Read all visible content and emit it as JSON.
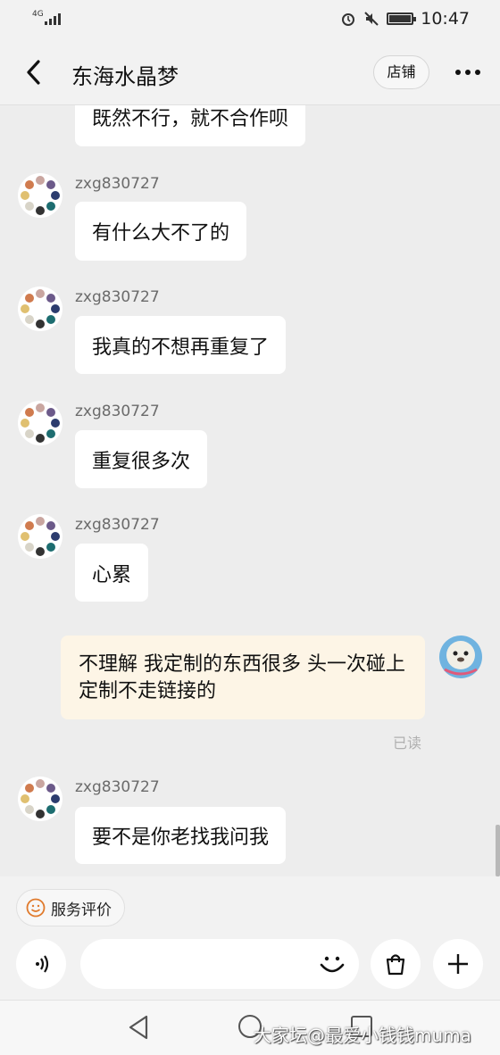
{
  "status_bar": {
    "network": "4G",
    "time": "10:47"
  },
  "header": {
    "title": "东海水晶梦",
    "shop_label": "店铺"
  },
  "messages": [
    {
      "sender": "",
      "text": "既然不行，就不合作呗"
    },
    {
      "sender": "zxg830727",
      "text": "有什么大不了的"
    },
    {
      "sender": "zxg830727",
      "text": "我真的不想再重复了"
    },
    {
      "sender": "zxg830727",
      "text": "重复很多次"
    },
    {
      "sender": "zxg830727",
      "text": "心累"
    },
    {
      "sender": "me",
      "text": "不理解 我定制的东西很多 头一次碰上定制不走链接的",
      "status": "已读"
    },
    {
      "sender": "zxg830727",
      "text": "要不是你老找我问我"
    }
  ],
  "rating": {
    "label": "服务评价"
  },
  "input": {
    "placeholder": ""
  },
  "watermark": "大家坛@最爱小钱钱muma",
  "icons": {
    "back": "chevron-left-icon",
    "more": "more-dots-icon",
    "voice": "voice-icon",
    "emoji": "smile-icon",
    "shop": "bag-icon",
    "add": "plus-icon"
  },
  "colors": {
    "background": "#ededed",
    "bubble_other": "#ffffff",
    "bubble_mine": "#fdf5e6"
  }
}
